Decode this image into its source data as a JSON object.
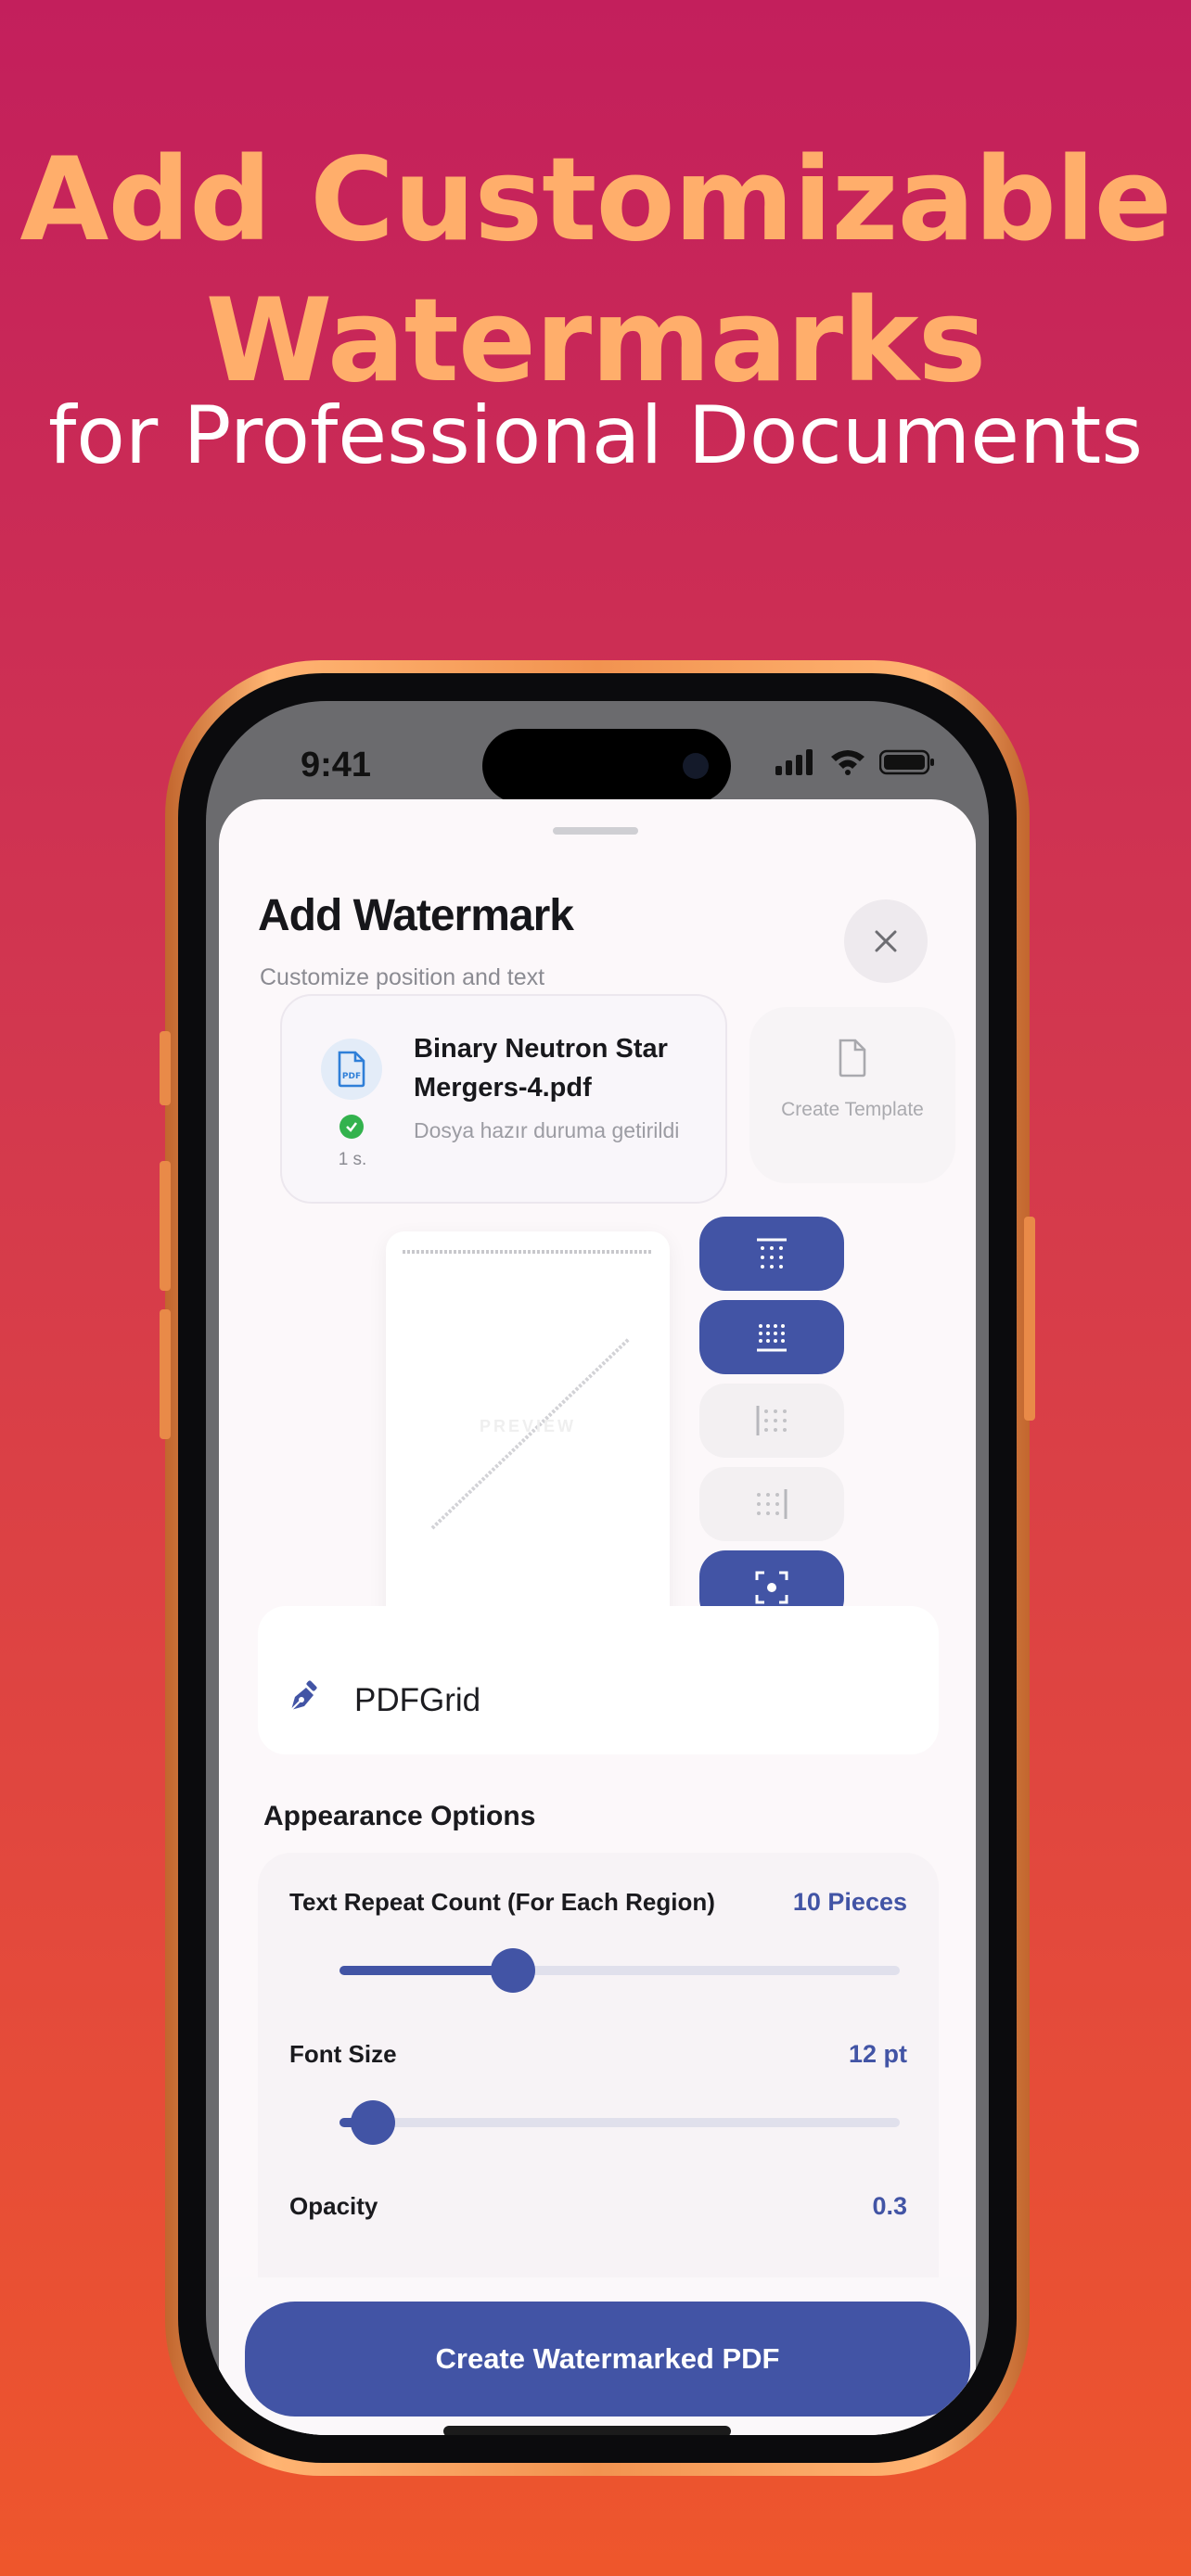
{
  "headline": {
    "line1": "Add Customizable",
    "line2": "Watermarks",
    "line3": "for Professional Documents"
  },
  "colors": {
    "accent": "#4254a5",
    "headline_orange": "#ffae6b",
    "success": "#33b24d"
  },
  "status_bar": {
    "time": "9:41"
  },
  "sheet": {
    "title": "Add Watermark",
    "subtitle": "Customize position and text",
    "close_icon": "close-icon"
  },
  "file": {
    "name": "Binary Neutron Star Mergers-4.pdf",
    "status": "Dosya hazır duruma getirildi",
    "pages": "1 s.",
    "icon": "pdf-file-icon"
  },
  "template_button": {
    "label": "Create Template",
    "icon": "document-icon"
  },
  "preview": {
    "label": "PREVIEW"
  },
  "positions": [
    {
      "name": "top-grid",
      "active": true
    },
    {
      "name": "full-grid",
      "active": true
    },
    {
      "name": "left-grid",
      "active": false
    },
    {
      "name": "right-grid",
      "active": false
    },
    {
      "name": "center",
      "active": true
    }
  ],
  "watermark_text": {
    "value": "PDFGrid",
    "icon": "pen-icon"
  },
  "appearance": {
    "title": "Appearance Options",
    "repeat": {
      "label": "Text Repeat Count (For Each Region)",
      "value": "10 Pieces",
      "level": 0.31
    },
    "font_size": {
      "label": "Font Size",
      "value": "12 pt",
      "level": 0.06
    },
    "opacity": {
      "label": "Opacity",
      "value": "0.3"
    }
  },
  "cta": {
    "label": "Create Watermarked PDF"
  }
}
